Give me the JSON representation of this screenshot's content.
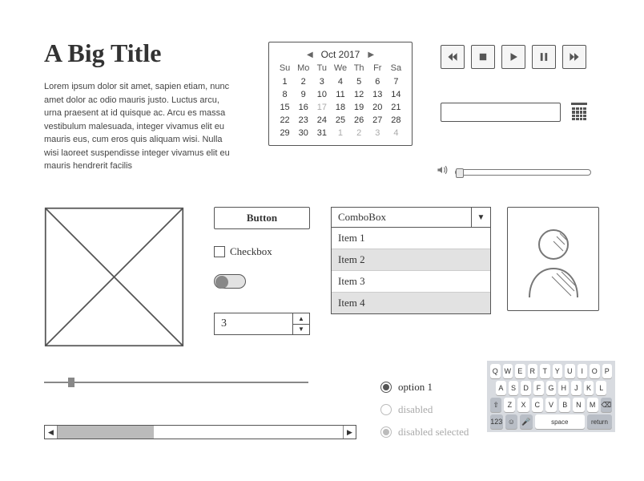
{
  "title": "A Big Title",
  "paragraph": "Lorem ipsum dolor sit amet, sapien etiam, nunc amet dolor ac odio mauris justo. Luctus arcu, urna praesent at id quisque ac. Arcu es massa vestibulum malesuada, integer vivamus elit eu mauris eus, cum eros quis aliquam wisi. Nulla wisi laoreet suspendisse integer vivamus elit eu mauris hendrerit facilis",
  "calendar": {
    "title": "Oct  2017",
    "dow": [
      "Su",
      "Mo",
      "Tu",
      "We",
      "Th",
      "Fr",
      "Sa"
    ],
    "days": [
      {
        "n": "1"
      },
      {
        "n": "2"
      },
      {
        "n": "3"
      },
      {
        "n": "4"
      },
      {
        "n": "5"
      },
      {
        "n": "6"
      },
      {
        "n": "7"
      },
      {
        "n": "8"
      },
      {
        "n": "9"
      },
      {
        "n": "10"
      },
      {
        "n": "11"
      },
      {
        "n": "12"
      },
      {
        "n": "13"
      },
      {
        "n": "14"
      },
      {
        "n": "15"
      },
      {
        "n": "16"
      },
      {
        "n": "17",
        "muted": true
      },
      {
        "n": "18"
      },
      {
        "n": "19"
      },
      {
        "n": "20"
      },
      {
        "n": "21"
      },
      {
        "n": "22"
      },
      {
        "n": "23"
      },
      {
        "n": "24"
      },
      {
        "n": "25"
      },
      {
        "n": "26"
      },
      {
        "n": "27"
      },
      {
        "n": "28"
      },
      {
        "n": "29"
      },
      {
        "n": "30"
      },
      {
        "n": "31"
      },
      {
        "n": "1",
        "muted": true
      },
      {
        "n": "2",
        "muted": true
      },
      {
        "n": "3",
        "muted": true
      },
      {
        "n": "4",
        "muted": true
      }
    ]
  },
  "button_label": "Button",
  "checkbox_label": "Checkbox",
  "spinner_value": "3",
  "combo": {
    "label": "ComboBox",
    "items": [
      "Item 1",
      "Item 2",
      "Item 3",
      "Item 4"
    ]
  },
  "radios": {
    "opt1": "option 1",
    "opt2": "disabled",
    "opt3": "disabled selected"
  },
  "keyboard": {
    "row1": [
      "Q",
      "W",
      "E",
      "R",
      "T",
      "Y",
      "U",
      "I",
      "O",
      "P"
    ],
    "row2": [
      "A",
      "S",
      "D",
      "F",
      "G",
      "H",
      "J",
      "K",
      "L"
    ],
    "row3_shift": "⇧",
    "row3": [
      "Z",
      "X",
      "C",
      "V",
      "B",
      "N",
      "M"
    ],
    "row3_del": "⌫",
    "row4": {
      "num": "123",
      "emoji": "☺",
      "mic": "🎤",
      "space": "space",
      "return": "return"
    }
  }
}
